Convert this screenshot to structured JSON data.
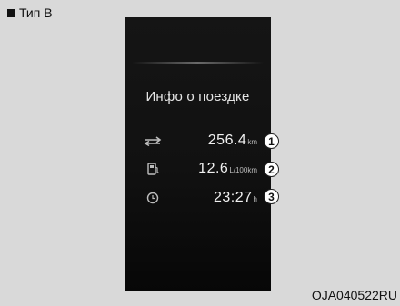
{
  "header": {
    "label": "Тип B"
  },
  "display": {
    "title": "Инфо о поездке",
    "items": [
      {
        "icon": "range-icon",
        "value": "256.4",
        "unit": "km",
        "callout": "1"
      },
      {
        "icon": "fuel-pump-icon",
        "value": "12.6",
        "unit": "L/100km",
        "callout": "2"
      },
      {
        "icon": "clock-icon",
        "value": "23:27",
        "unit": "h",
        "callout": "3"
      }
    ]
  },
  "figure_code": "OJA040522RU"
}
